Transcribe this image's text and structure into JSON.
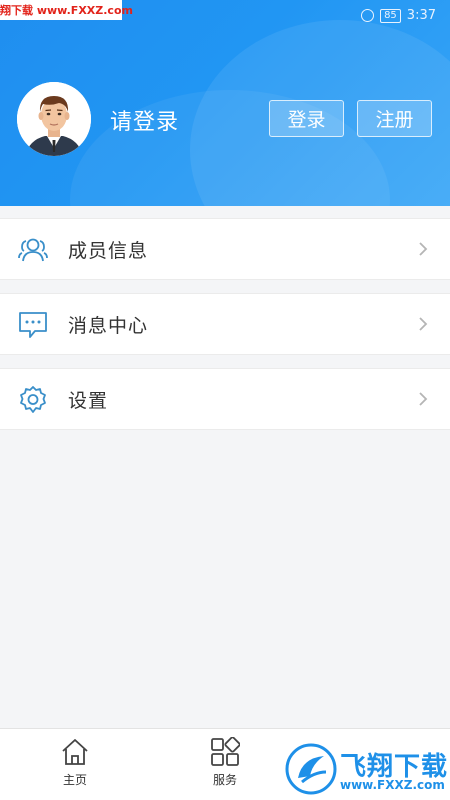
{
  "watermark_top": "飞翔下载 www.FXXZ.com",
  "status": {
    "battery": "85",
    "time": "3:37"
  },
  "profile": {
    "login_prompt": "请登录",
    "login_button": "登录",
    "register_button": "注册"
  },
  "menu": [
    {
      "label": "成员信息",
      "icon": "people-icon"
    },
    {
      "label": "消息中心",
      "icon": "message-icon"
    },
    {
      "label": "设置",
      "icon": "gear-icon"
    }
  ],
  "tabs": [
    {
      "label": "主页",
      "icon": "home-icon"
    },
    {
      "label": "服务",
      "icon": "grid-icon"
    }
  ],
  "watermark_bottom": {
    "brand": "飞翔下载",
    "url": "www.FXXZ.com"
  },
  "colors": {
    "header_blue": "#2196f3",
    "icon_blue": "#3a8fc9",
    "watermark_red": "#e2231a"
  }
}
